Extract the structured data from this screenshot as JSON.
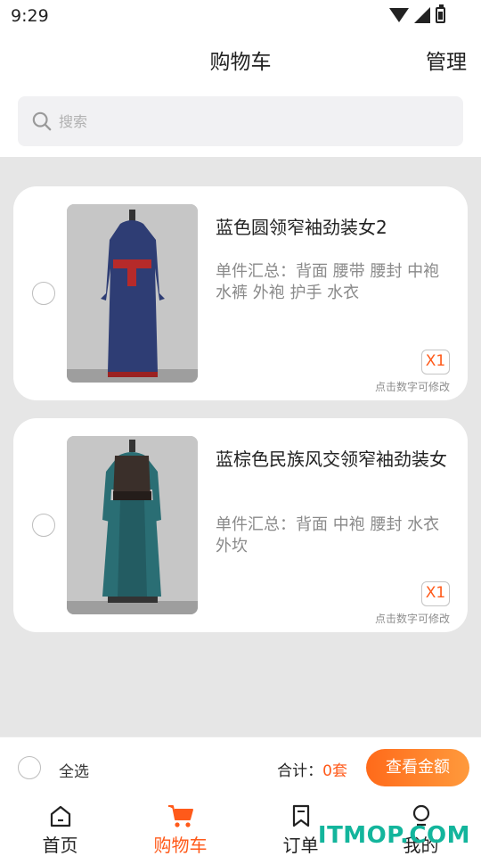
{
  "status_bar": {
    "time": "9:29"
  },
  "header": {
    "title": "购物车",
    "manage_label": "管理"
  },
  "search": {
    "placeholder": "搜索",
    "value": ""
  },
  "items": [
    {
      "name": "蓝色圆领窄袖劲装女2",
      "summary": "单件汇总：背面  腰带  腰封  中袍  水裤  外袍  护手  水衣",
      "quantity": "X1",
      "hint": "点击数字可修改",
      "image_icon": "costume-blue-robe",
      "robe_color": "#2e3d74",
      "selected": false
    },
    {
      "name": "蓝棕色民族风交领窄袖劲装女",
      "summary": "单件汇总：背面  中袍  腰封  水衣  外坎",
      "quantity": "X1",
      "hint": "点击数字可修改",
      "image_icon": "costume-teal-brown-robe",
      "robe_color": "#2a6e74",
      "selected": false
    }
  ],
  "footer": {
    "select_all_label": "全选",
    "total_label": "合计：",
    "total_value": "0套",
    "view_button_label": "查看金额"
  },
  "tabs": [
    {
      "label": "首页",
      "icon": "home-icon",
      "active": false
    },
    {
      "label": "购物车",
      "icon": "cart-icon",
      "active": true
    },
    {
      "label": "订单",
      "icon": "bookmark-icon",
      "active": false
    },
    {
      "label": "我的",
      "icon": "profile-icon",
      "active": false
    }
  ],
  "watermark": "ITMOP.COM",
  "colors": {
    "accent": "#ff5a1a",
    "background": "#e6e6e6",
    "watermark": "#13b59c"
  }
}
